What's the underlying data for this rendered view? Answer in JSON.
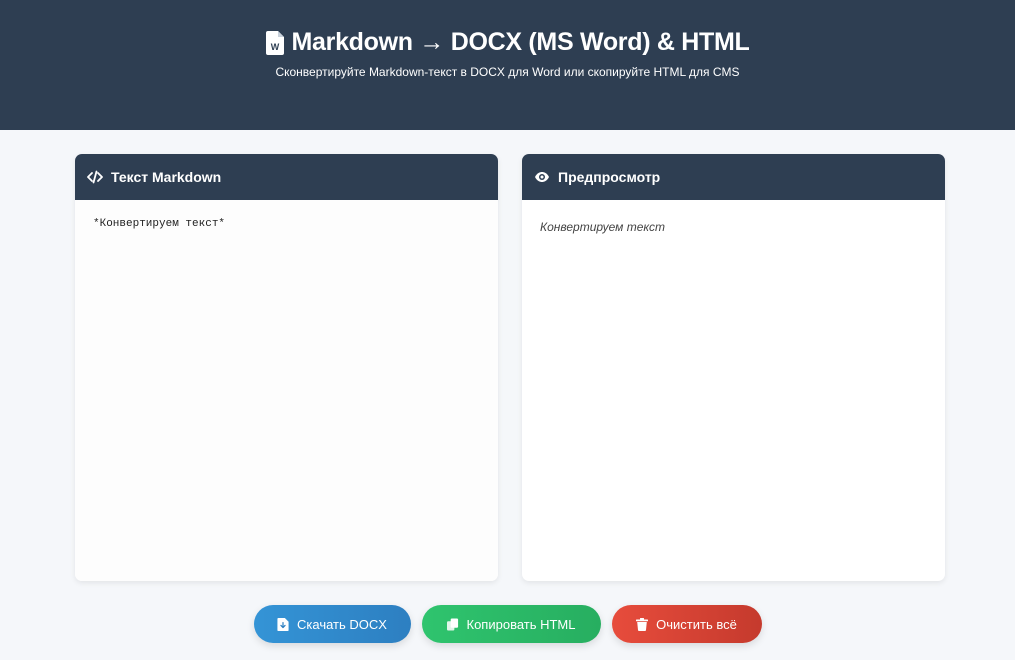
{
  "header": {
    "icon": "file-word-icon",
    "title": "Markdown → DOCX (MS Word) & HTML",
    "subtitle": "Сконвертируйте Markdown-текст в DOCX для Word или скопируйте HTML для CMS"
  },
  "editor_panel": {
    "icon": "code-icon",
    "title": "Текст Markdown",
    "value": "*Конвертируем текст*"
  },
  "preview_panel": {
    "icon": "eye-icon",
    "title": "Предпросмотр",
    "content": "Конвертируем текст"
  },
  "buttons": {
    "download": {
      "icon": "file-download-icon",
      "label": "Скачать DOCX",
      "color": "#3498db"
    },
    "copy": {
      "icon": "copy-icon",
      "label": "Копировать HTML",
      "color": "#2ecc71"
    },
    "clear": {
      "icon": "trash-icon",
      "label": "Очистить всё",
      "color": "#e74c3c"
    }
  },
  "colors": {
    "header_bg": "#2e3e52",
    "page_bg": "#f5f7fa"
  }
}
